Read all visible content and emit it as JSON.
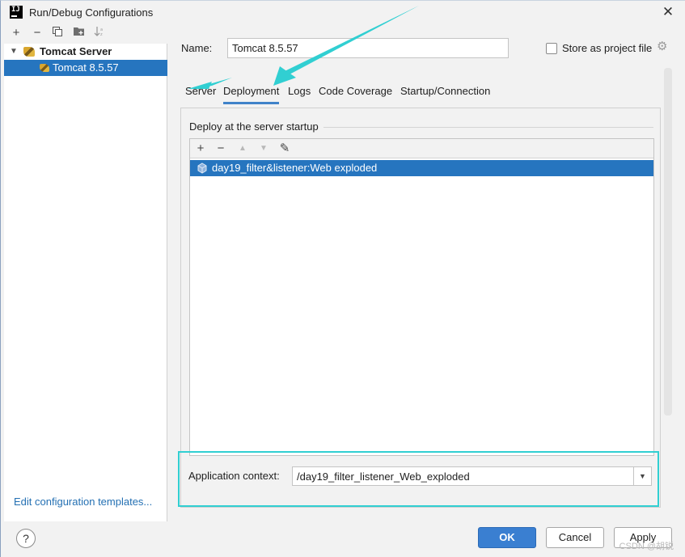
{
  "window": {
    "title": "Run/Debug Configurations",
    "close_icon": "close-icon"
  },
  "sidebar": {
    "toolbar": {
      "add": "+",
      "remove": "−",
      "copy": "❐",
      "folder": "▰",
      "sort": "↓"
    },
    "tree": [
      {
        "label": "Tomcat Server",
        "expanded": true
      },
      {
        "label": "Tomcat 8.5.57",
        "selected": true
      }
    ],
    "edit_templates_link": "Edit configuration templates..."
  },
  "form": {
    "name_label": "Name:",
    "name_value": "Tomcat 8.5.57",
    "store_label": "Store as project file",
    "store_checked": false
  },
  "tabs": [
    {
      "label": "Server"
    },
    {
      "label": "Deployment",
      "active": true
    },
    {
      "label": "Logs"
    },
    {
      "label": "Code Coverage"
    },
    {
      "label": "Startup/Connection"
    }
  ],
  "deployment": {
    "section_title": "Deploy at the server startup",
    "toolbar": {
      "add": "+",
      "remove": "−",
      "up": "▲",
      "down": "▼",
      "edit": "✎"
    },
    "artifacts": [
      "day19_filter&listener:Web exploded"
    ],
    "context_label": "Application context:",
    "context_value": "/day19_filter_listener_Web_exploded"
  },
  "buttons": {
    "help": "?",
    "ok": "OK",
    "cancel": "Cancel",
    "apply": "Apply"
  },
  "watermark": "CSDN @胡锐",
  "colors": {
    "selection": "#2675bf",
    "accent_tab": "#4083c9",
    "annotation": "#31cfd2",
    "link": "#2470b3"
  }
}
